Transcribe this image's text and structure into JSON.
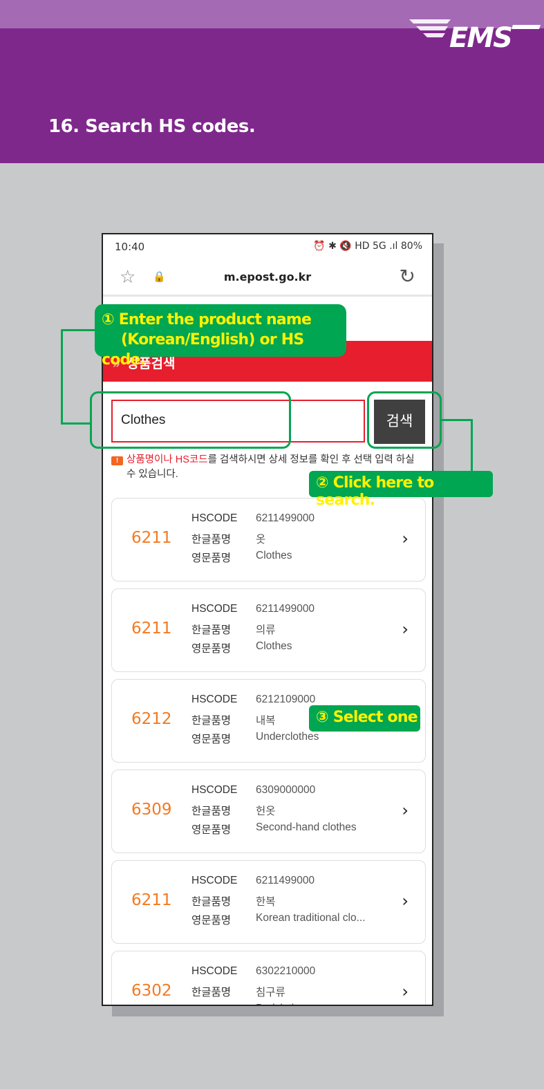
{
  "header": {
    "title": "16. Search HS codes.",
    "logo": "EMS",
    "colors": {
      "purple": "#7f288c",
      "light_purple": "#a46bb4",
      "callout_green": "#00a651",
      "callout_text": "#fff200"
    }
  },
  "status_bar": {
    "time": "10:40",
    "battery": "80%",
    "icons_right": "⏰ ✱ 🔇 HD 5G .ıl"
  },
  "browser": {
    "url": "m.epost.go.kr",
    "star_icon": "star-icon",
    "lock_icon": "lock-icon",
    "reload_icon": "reload-icon"
  },
  "page": {
    "banner_title": "상품검색",
    "search": {
      "value": "Clothes",
      "button": "검색"
    },
    "notice": {
      "highlight": "상품명이나 HS코드",
      "rest": "를 검색하시면 상세 정보를 확인 후 선택 입력 하실",
      "line2": "수 있습니다."
    },
    "labels": {
      "hscode": "HSCODE",
      "korean": "한글품명",
      "english": "영문품명"
    },
    "results": [
      {
        "hs": "6211",
        "code": "6211499000",
        "ko": "옷",
        "en": "Clothes"
      },
      {
        "hs": "6211",
        "code": "6211499000",
        "ko": "의류",
        "en": "Clothes"
      },
      {
        "hs": "6212",
        "code": "6212109000",
        "ko": "내복",
        "en": "Underclothes"
      },
      {
        "hs": "6309",
        "code": "6309000000",
        "ko": "헌옷",
        "en": "Second-hand clothes"
      },
      {
        "hs": "6211",
        "code": "6211499000",
        "ko": "한복",
        "en": "Korean traditional clo..."
      },
      {
        "hs": "6302",
        "code": "6302210000",
        "ko": "침구류",
        "en": "Bedclothes"
      }
    ]
  },
  "callouts": {
    "step1_num": "①",
    "step1_line1": "Enter the product name",
    "step1_line2": "(Korean/English) or HS code.",
    "step2_num": "②",
    "step2": "Click here to search.",
    "step3_num": "③",
    "step3": "Select one"
  }
}
